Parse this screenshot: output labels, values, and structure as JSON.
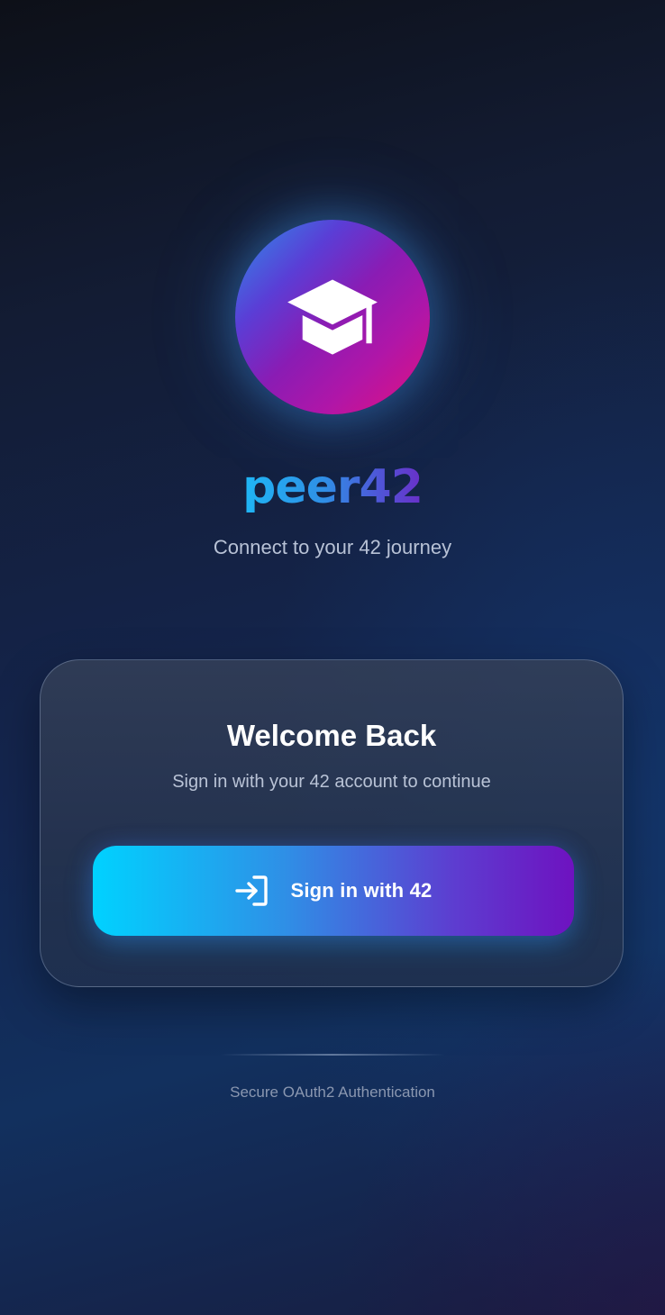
{
  "app": {
    "name": "peer42",
    "tagline": "Connect to your 42 journey",
    "logo_icon": "graduation-cap-icon"
  },
  "card": {
    "title": "Welcome Back",
    "subtitle": "Sign in with your 42 account to continue",
    "signin_button": {
      "label": "Sign in with 42",
      "icon": "login-icon"
    }
  },
  "footer": {
    "text": "Secure OAuth2 Authentication"
  },
  "colors": {
    "background_top": "#0d1018",
    "background_mid": "#142650",
    "brand_gradient_start": "#1fb6f5",
    "brand_gradient_end": "#6a2fc8",
    "logo_gradient_start": "#2d8fe8",
    "logo_gradient_mid": "#8a1cb4",
    "logo_gradient_end": "#e3107e",
    "button_gradient_start": "#00d2ff",
    "button_gradient_end": "#6e12c0",
    "tagline_text": "#b8c2d6",
    "footer_text": "#8a97b0"
  }
}
